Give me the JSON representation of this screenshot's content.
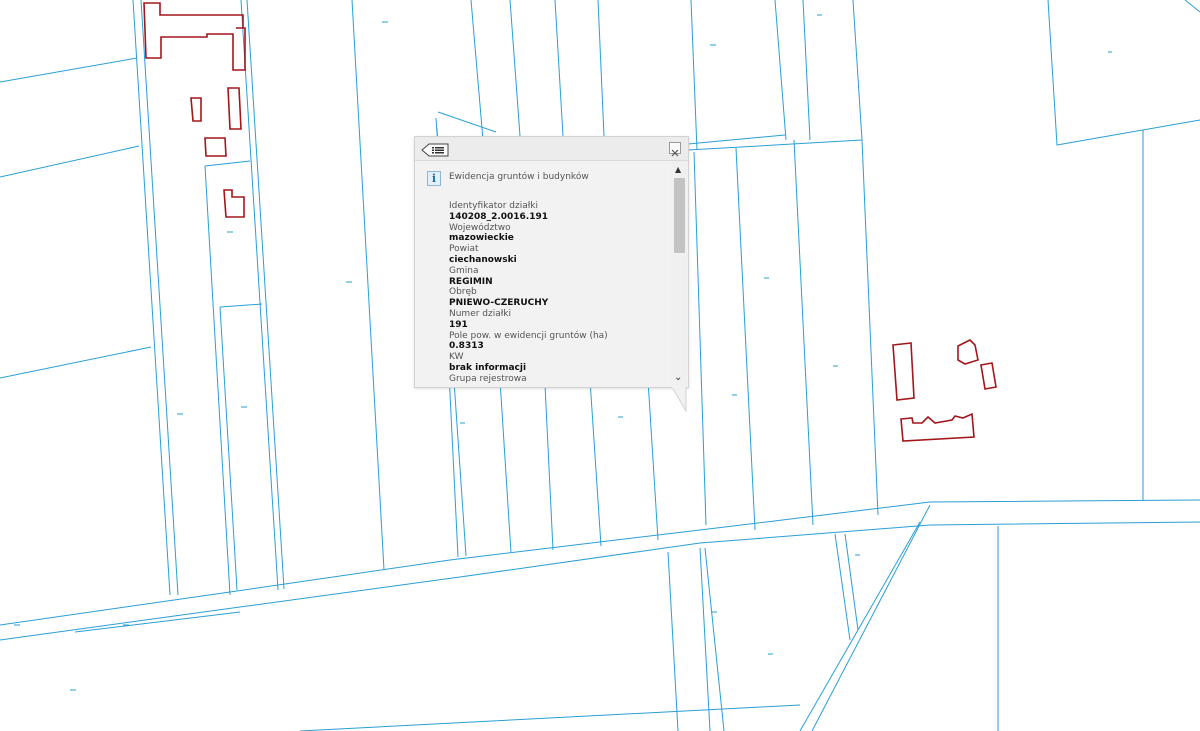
{
  "map": {
    "parcel_color": "#2a9fd6",
    "building_color": "#a3161b",
    "background": "#ffffff"
  },
  "popup": {
    "list_icon": "list-icon",
    "close_icon": "close-icon",
    "info_icon_text": "i",
    "layer_title": "Ewidencja gruntów i budynków",
    "attributes": [
      {
        "label": "Identyfikator działki",
        "value": "140208_2.0016.191"
      },
      {
        "label": "Województwo",
        "value": "mazowieckie"
      },
      {
        "label": "Powiat",
        "value": "ciechanowski"
      },
      {
        "label": "Gmina",
        "value": "REGIMIN"
      },
      {
        "label": "Obręb",
        "value": "PNIEWO-CZERUCHY"
      },
      {
        "label": "Numer działki",
        "value": "191"
      },
      {
        "label": "Pole pow. w ewidencji gruntów (ha)",
        "value": "0.8313"
      },
      {
        "label": "KW",
        "value": "brak informacji"
      },
      {
        "label": "Grupa rejestrowa",
        "value": ""
      }
    ]
  }
}
